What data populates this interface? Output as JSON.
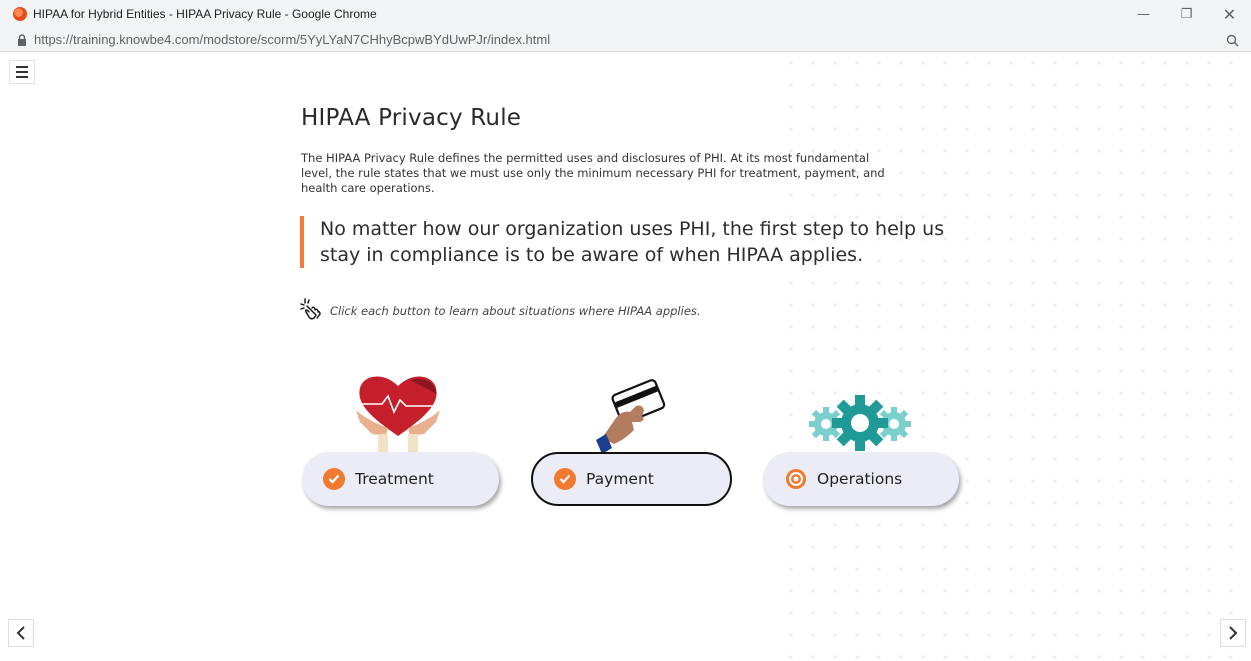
{
  "window": {
    "title": "HIPAA for Hybrid Entities - HIPAA Privacy Rule - Google Chrome",
    "controls": [
      "minimize",
      "restore",
      "close"
    ]
  },
  "address": {
    "url": "https://training.knowbe4.com/modstore/scorm/5YyLYaN7CHhyBcpwBYdUwPJr/index.html"
  },
  "page": {
    "title": "HIPAA Privacy Rule",
    "intro": "The HIPAA Privacy Rule defines the permitted uses and disclosures of PHI. At its most fundamental level, the rule states that we must use only the minimum necessary PHI for treatment, payment, and health care operations.",
    "callout": "No matter how our organization uses PHI, the first step to help us stay in compliance is to be aware of when HIPAA applies.",
    "hint": "Click each button to learn about situations where HIPAA applies."
  },
  "topics": [
    {
      "label": "Treatment",
      "state": "visited"
    },
    {
      "label": "Payment",
      "state": "visited-selected"
    },
    {
      "label": "Operations",
      "state": "unvisited"
    }
  ],
  "colors": {
    "accent": "#ef7a30",
    "heart": "#c41f2b",
    "gear": "#2aa8a4",
    "button_bg": "#ececf6"
  }
}
